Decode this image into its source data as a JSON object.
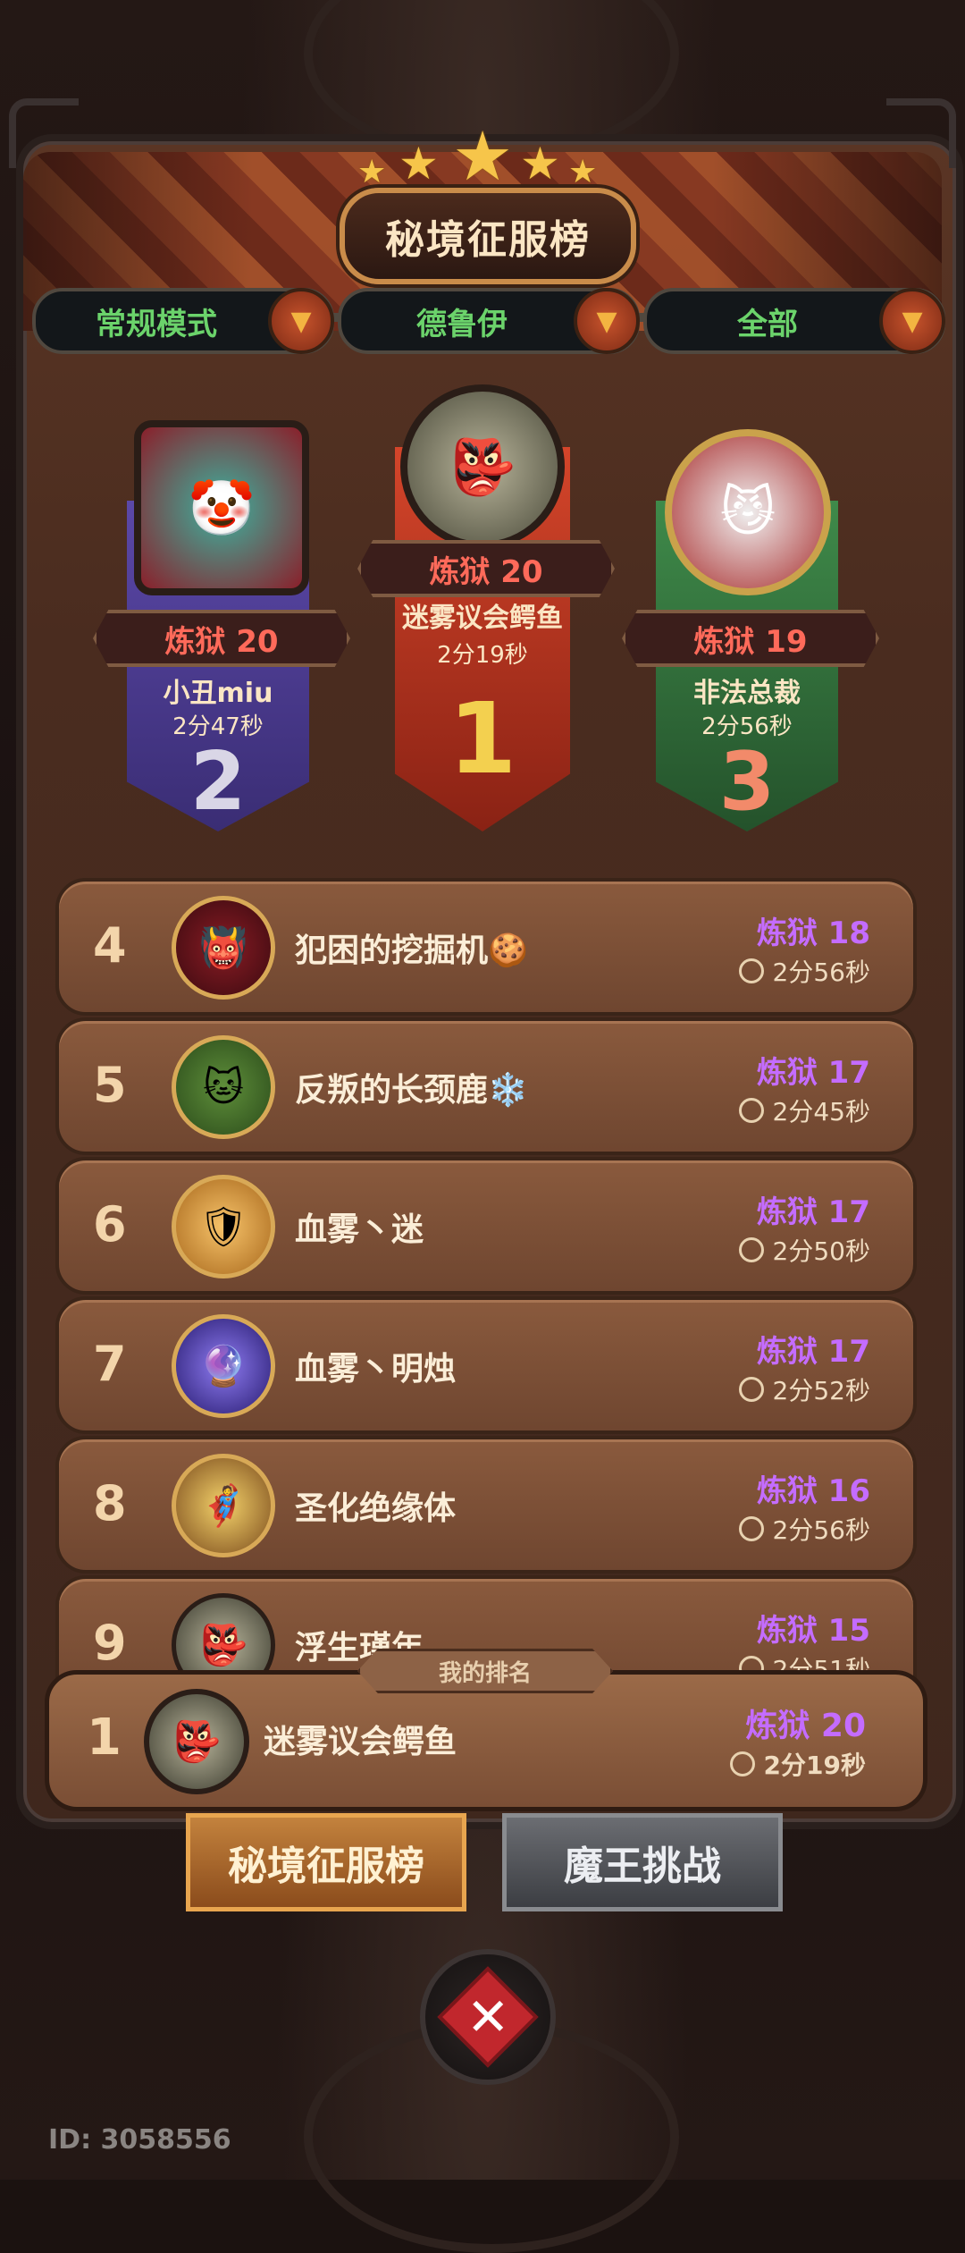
{
  "header": {
    "title": "秘境征服榜",
    "star_icon": "star-icon"
  },
  "filters": [
    {
      "label": "常规模式",
      "icon": "chevron-down-icon"
    },
    {
      "label": "德鲁伊",
      "icon": "chevron-down-icon"
    },
    {
      "label": "全部",
      "icon": "chevron-down-icon"
    }
  ],
  "podium": [
    {
      "rank": "2",
      "tier": "炼狱 20",
      "name": "小丑miu",
      "time": "2分47秒",
      "avatar": "clown-avatar-icon",
      "color": "#4d3a8c"
    },
    {
      "rank": "1",
      "tier": "炼狱 20",
      "name": "迷雾议会鳄鱼",
      "time": "2分19秒",
      "avatar": "goblin-avatar-icon",
      "color": "#b8351f"
    },
    {
      "rank": "3",
      "tier": "炼狱 19",
      "name": "非法总裁",
      "time": "2分56秒",
      "avatar": "cat-dragon-avatar-icon",
      "color": "#2f6b39"
    }
  ],
  "rankings": [
    {
      "rank": "4",
      "name": "犯困的挖掘机",
      "badge": "🍪",
      "tier": "炼狱 18",
      "time": "2分56秒",
      "avatar": "demon-avatar-icon"
    },
    {
      "rank": "5",
      "name": "反叛的长颈鹿",
      "badge": "❄️",
      "tier": "炼狱 17",
      "time": "2分45秒",
      "avatar": "hooded-cat-avatar-icon"
    },
    {
      "rank": "6",
      "name": "血雾丶迷",
      "badge": "",
      "tier": "炼狱 17",
      "time": "2分50秒",
      "avatar": "knight-avatar-icon"
    },
    {
      "rank": "7",
      "name": "血雾丶明烛",
      "badge": "",
      "tier": "炼狱 17",
      "time": "2分52秒",
      "avatar": "orb-avatar-icon"
    },
    {
      "rank": "8",
      "name": "圣化绝缘体",
      "badge": "",
      "tier": "炼狱 16",
      "time": "2分56秒",
      "avatar": "blonde-hero-avatar-icon"
    },
    {
      "rank": "9",
      "name": "浮生瑾年",
      "badge": "",
      "tier": "炼狱 15",
      "time": "2分51秒",
      "avatar": "goblin-avatar-icon"
    }
  ],
  "my_rank": {
    "label": "我的排名",
    "rank": "1",
    "name": "迷雾议会鳄鱼",
    "tier": "炼狱 20",
    "time": "2分19秒",
    "avatar": "goblin-avatar-icon"
  },
  "tabs": {
    "active": "秘境征服榜",
    "inactive": "魔王挑战"
  },
  "footer": {
    "user_id": "ID: 3058556"
  }
}
